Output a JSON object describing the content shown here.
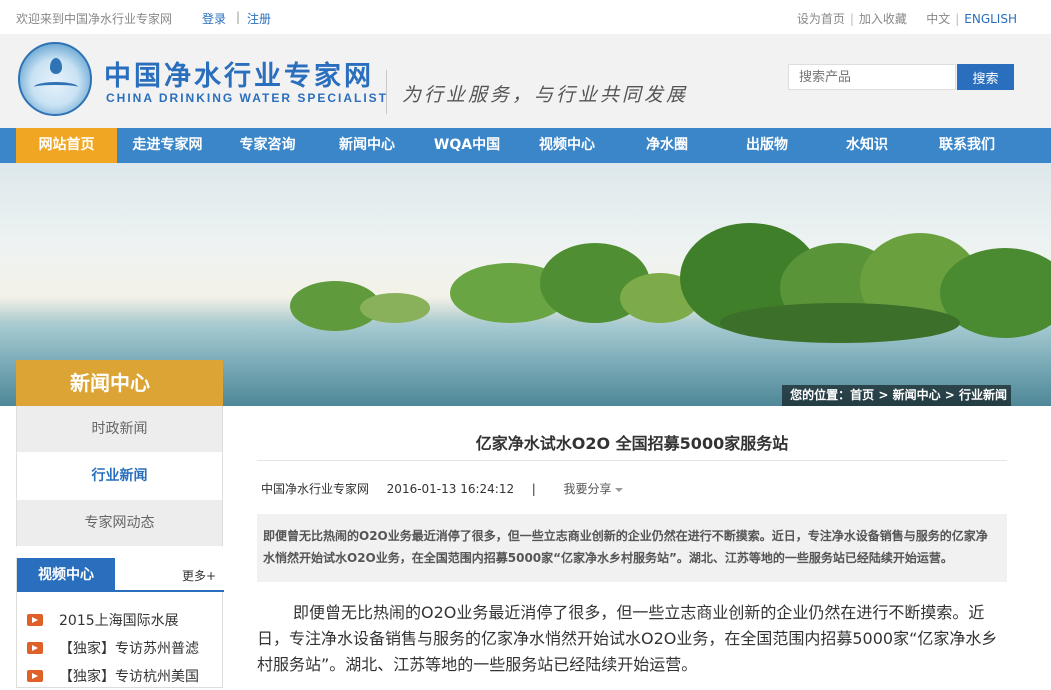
{
  "topbar": {
    "welcome": "欢迎来到中国净水行业专家网",
    "login": "登录",
    "separator": "|",
    "register": "注册",
    "set_home": "设为首页",
    "add_favorite": "加入收藏",
    "lang_cn": "中文",
    "lang_en": "ENGLISH"
  },
  "header": {
    "logo_cn": "中国净水行业专家网",
    "logo_en": "CHINA DRINKING WATER SPECIALIST",
    "slogan": "为行业服务，与行业共同发展",
    "search_placeholder": "搜索产品",
    "search_button": "搜索"
  },
  "nav": {
    "items": [
      {
        "label": "网站首页",
        "active": true
      },
      {
        "label": "走进专家网"
      },
      {
        "label": "专家咨询"
      },
      {
        "label": "新闻中心"
      },
      {
        "label": "WQA中国"
      },
      {
        "label": "视频中心"
      },
      {
        "label": "净水圈"
      },
      {
        "label": "出版物"
      },
      {
        "label": "水知识"
      },
      {
        "label": "联系我们"
      }
    ]
  },
  "banner": {
    "section_title": "新闻中心",
    "breadcrumb": "您的位置：首页 > 新闻中心 > 行业新闻"
  },
  "sidebar": {
    "items": [
      {
        "label": "时政新闻"
      },
      {
        "label": "行业新闻",
        "active": true
      },
      {
        "label": "专家网动态"
      }
    ],
    "video": {
      "title": "视频中心",
      "more": "更多+",
      "items": [
        "2015上海国际水展",
        "【独家】专访苏州普滤",
        "【独家】专访杭州美国"
      ]
    }
  },
  "article": {
    "title": "亿家净水试水O2O 全国招募5000家服务站",
    "source": "中国净水行业专家网",
    "datetime": "2016-01-13 16:24:12",
    "meta_sep": "|",
    "share": "我要分享",
    "summary": "即便曾无比热闹的O2O业务最近消停了很多，但一些立志商业创新的企业仍然在进行不断摸索。近日，专注净水设备销售与服务的亿家净水悄然开始试水O2O业务，在全国范围内招募5000家“亿家净水乡村服务站”。湖北、江苏等地的一些服务站已经陆续开始运营。",
    "body": "即便曾无比热闹的O2O业务最近消停了很多，但一些立志商业创新的企业仍然在进行不断摸索。近日，专注净水设备销售与服务的亿家净水悄然开始试水O2O业务，在全国范围内招募5000家“亿家净水乡村服务站”。湖北、江苏等地的一些服务站已经陆续开始运营。"
  },
  "colors": {
    "brand_blue": "#2a6fbd",
    "nav_blue": "#3a86c9",
    "accent_orange": "#f0a623",
    "section_gold": "#dba435"
  }
}
